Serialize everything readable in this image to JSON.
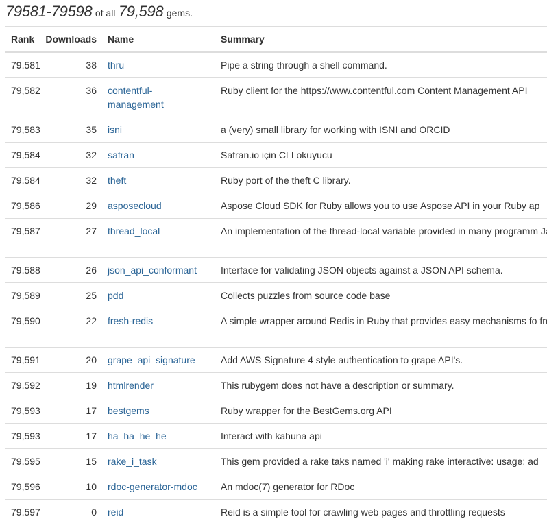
{
  "header": {
    "range": "79581-79598",
    "of_all": "of all",
    "total": "79,598",
    "gems": "gems."
  },
  "columns": {
    "rank": "Rank",
    "downloads": "Downloads",
    "name": "Name",
    "summary": "Summary"
  },
  "rows": [
    {
      "rank": "79,581",
      "downloads": "38",
      "name": "thru",
      "summary": "Pipe a string through a shell command.",
      "lines": 1
    },
    {
      "rank": "79,582",
      "downloads": "36",
      "name": "contentful-management",
      "summary": "Ruby client for the https://www.contentful.com Content Management API",
      "lines": 2
    },
    {
      "rank": "79,583",
      "downloads": "35",
      "name": "isni",
      "summary": "a (very) small library for working with ISNI and ORCID",
      "lines": 1
    },
    {
      "rank": "79,584",
      "downloads": "32",
      "name": "safran",
      "summary": "Safran.io için CLI okuyucu",
      "lines": 1
    },
    {
      "rank": "79,584",
      "downloads": "32",
      "name": "theft",
      "summary": "Ruby port of the theft C library.",
      "lines": 1
    },
    {
      "rank": "79,586",
      "downloads": "29",
      "name": "asposecloud",
      "summary": "Aspose Cloud SDK for Ruby allows you to use Aspose API in your Ruby ap",
      "lines": 1
    },
    {
      "rank": "79,587",
      "downloads": "27",
      "name": "thread_local",
      "summary": "An implementation of the thread-local variable provided in many programm Java.",
      "lines": 2
    },
    {
      "rank": "79,588",
      "downloads": "26",
      "name": "json_api_conformant",
      "summary": "Interface for validating JSON objects against a JSON API schema.",
      "lines": 1
    },
    {
      "rank": "79,589",
      "downloads": "25",
      "name": "pdd",
      "summary": "Collects puzzles from source code base",
      "lines": 1
    },
    {
      "rank": "79,590",
      "downloads": "22",
      "name": "fresh-redis",
      "summary": "A simple wrapper around Redis in Ruby that provides easy mechanisms fo fresh,...",
      "lines": 2
    },
    {
      "rank": "79,591",
      "downloads": "20",
      "name": "grape_api_signature",
      "summary": "Add AWS Signature 4 style authentication to grape API's.",
      "lines": 1
    },
    {
      "rank": "79,592",
      "downloads": "19",
      "name": "htmlrender",
      "summary": "This rubygem does not have a description or summary.",
      "lines": 1
    },
    {
      "rank": "79,593",
      "downloads": "17",
      "name": "bestgems",
      "summary": "Ruby wrapper for the BestGems.org API",
      "lines": 1
    },
    {
      "rank": "79,593",
      "downloads": "17",
      "name": "ha_ha_he_he",
      "summary": "Interact with kahuna api",
      "lines": 1
    },
    {
      "rank": "79,595",
      "downloads": "15",
      "name": "rake_i_task",
      "summary": "This gem provided a rake taks named 'i' making rake interactive: usage: ad",
      "lines": 1
    },
    {
      "rank": "79,596",
      "downloads": "10",
      "name": "rdoc-generator-mdoc",
      "summary": "An mdoc(7) generator for RDoc",
      "lines": 1
    },
    {
      "rank": "79,597",
      "downloads": "0",
      "name": "reid",
      "summary": "Reid is a simple tool for crawling web pages and throttling requests",
      "lines": 1
    }
  ],
  "colors": {
    "link": "#2a6496",
    "text": "#333333",
    "border": "#dddddd"
  }
}
